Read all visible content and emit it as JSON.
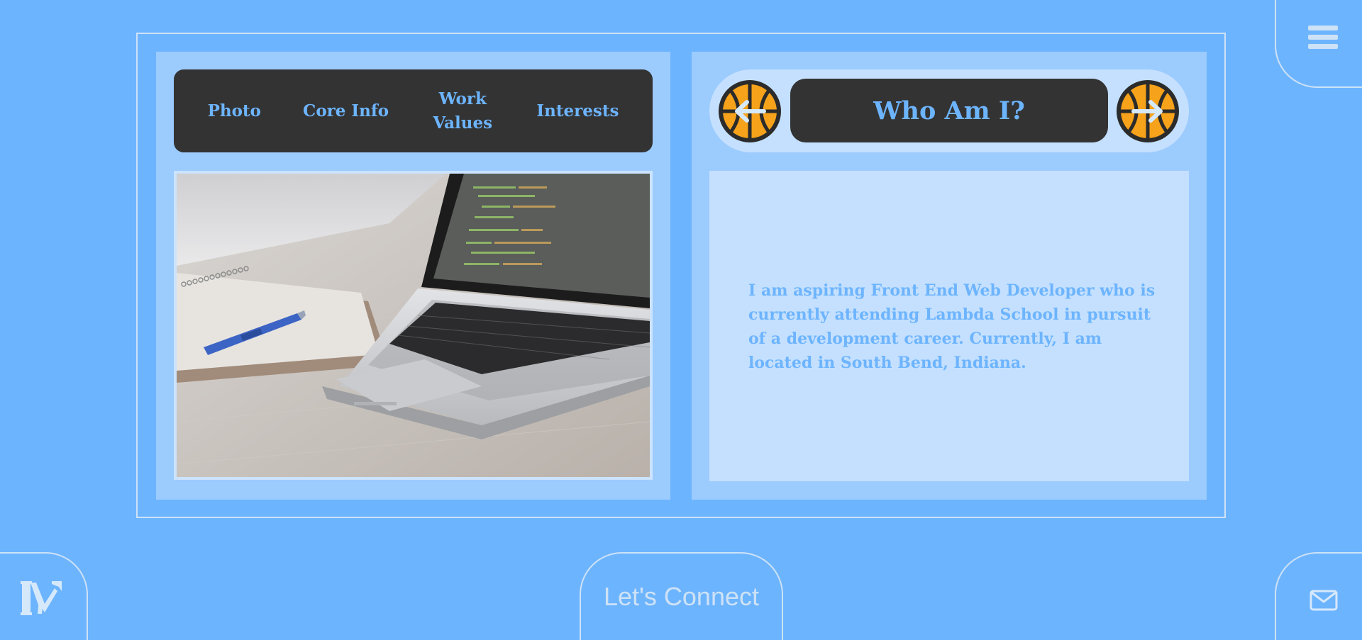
{
  "nav": {
    "items": [
      {
        "label": "Photo"
      },
      {
        "label": "Core Info"
      },
      {
        "label": "Work Values"
      },
      {
        "label": "Interests"
      }
    ]
  },
  "section": {
    "title": "Who Am I?",
    "body": "I am aspiring Front End Web Developer who is currently attending Lambda School in pursuit of a development career. Currently, I am located in South Bend, Indiana."
  },
  "footer": {
    "connect_label": "Let's Connect"
  },
  "icons": {
    "menu": "hamburger-menu-icon",
    "prev": "basketball-arrow-left-icon",
    "next": "basketball-arrow-right-icon",
    "logo": "brand-logo-icon",
    "mail": "mail-icon"
  },
  "colors": {
    "background": "#6db4fe",
    "panel": "#9ccbfe",
    "card": "#c4e0fe",
    "dark": "#333333",
    "accent": "#6db4fe",
    "ball": "#f6a21a",
    "outline": "#cde2f6"
  }
}
